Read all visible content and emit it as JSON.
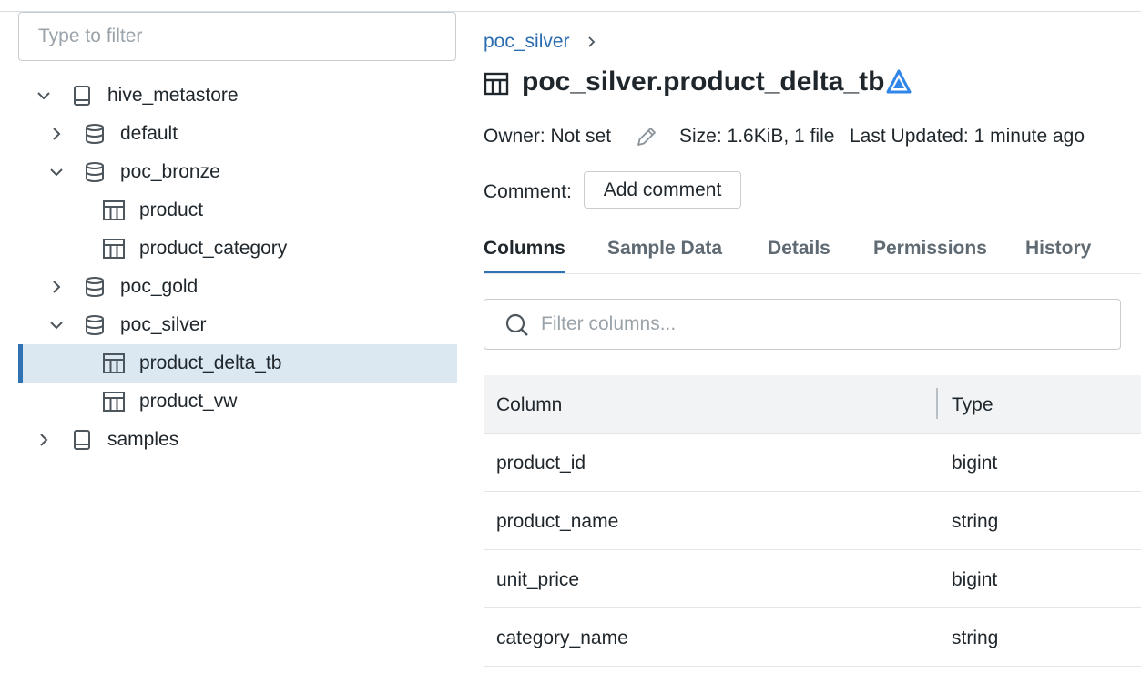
{
  "filter": {
    "placeholder": "Type to filter"
  },
  "tree": {
    "hive_metastore": "hive_metastore",
    "default": "default",
    "poc_bronze": "poc_bronze",
    "product": "product",
    "product_category": "product_category",
    "poc_gold": "poc_gold",
    "poc_silver": "poc_silver",
    "product_delta_tb": "product_delta_tb",
    "product_vw": "product_vw",
    "samples": "samples",
    "selected": "product_delta_tb"
  },
  "breadcrumb": {
    "schema": "poc_silver"
  },
  "header": {
    "title": "poc_silver.product_delta_tb"
  },
  "meta": {
    "owner": "Owner: Not set",
    "size": "Size: 1.6KiB, 1 file",
    "updated": "Last Updated: 1 minute ago"
  },
  "comment": {
    "label": "Comment:",
    "button": "Add comment"
  },
  "tabs": [
    "Columns",
    "Sample Data",
    "Details",
    "Permissions",
    "History"
  ],
  "active_tab": "Columns",
  "column_filter": {
    "placeholder": "Filter columns..."
  },
  "table": {
    "headers": [
      "Column",
      "Type"
    ],
    "rows": [
      [
        "product_id",
        "bigint"
      ],
      [
        "product_name",
        "string"
      ],
      [
        "unit_price",
        "bigint"
      ],
      [
        "category_name",
        "string"
      ]
    ]
  },
  "colors": {
    "link": "#2a6cb0",
    "selected_bg": "#dbe7f1",
    "accent": "#2f73b4",
    "delta_icon": "#2f86e8"
  },
  "icons": [
    "chevron-down-icon",
    "chevron-right-icon",
    "catalog-book-icon",
    "database-icon",
    "table-icon",
    "delta-icon",
    "pencil-icon",
    "search-icon"
  ]
}
